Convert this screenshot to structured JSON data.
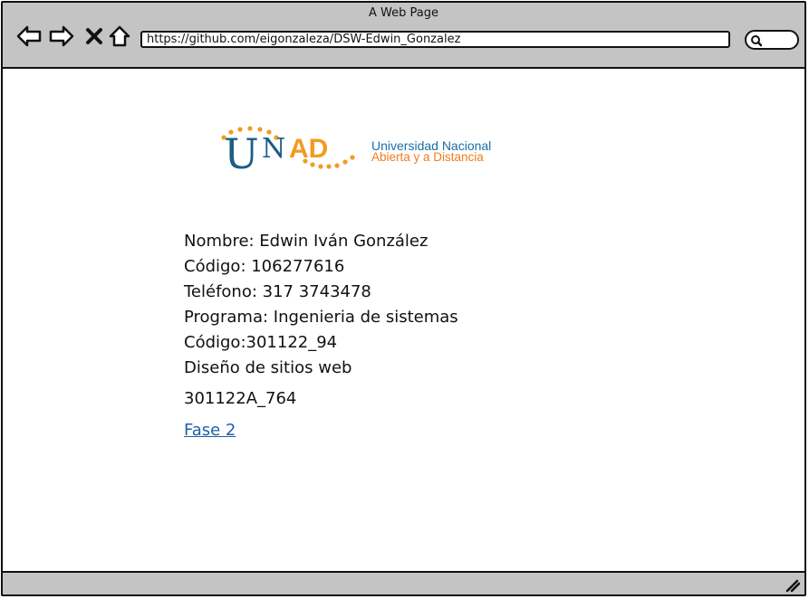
{
  "window": {
    "title": "A Web Page"
  },
  "toolbar": {
    "back_icon": "back-arrow-icon",
    "forward_icon": "forward-arrow-icon",
    "close_icon": "close-x-icon",
    "home_icon": "home-icon",
    "url": "https://github.com/eigonzaleza/DSW-Edwin_Gonzalez",
    "search_icon": "search-icon"
  },
  "logo": {
    "letters_u": "U",
    "letters_n": "N",
    "letters_ad": "AD",
    "line1": "Universidad Nacional",
    "line2": "Abierta y a Distancia",
    "colors": {
      "blue": "#1a5e86",
      "orange": "#f39a23",
      "text_blue": "#1a6fa3",
      "text_orange": "#f07c1c"
    }
  },
  "profile": {
    "nombre": "Nombre: Edwin Iván González",
    "codigo": "Código: 106277616",
    "telefono": "Teléfono: 317 3743478",
    "programa": "Programa: Ingenieria de sistemas",
    "codigo_curso": "Código:301122_94",
    "curso": "Diseño de sitios web",
    "grupo": "301122A_764",
    "link": "Fase 2"
  }
}
